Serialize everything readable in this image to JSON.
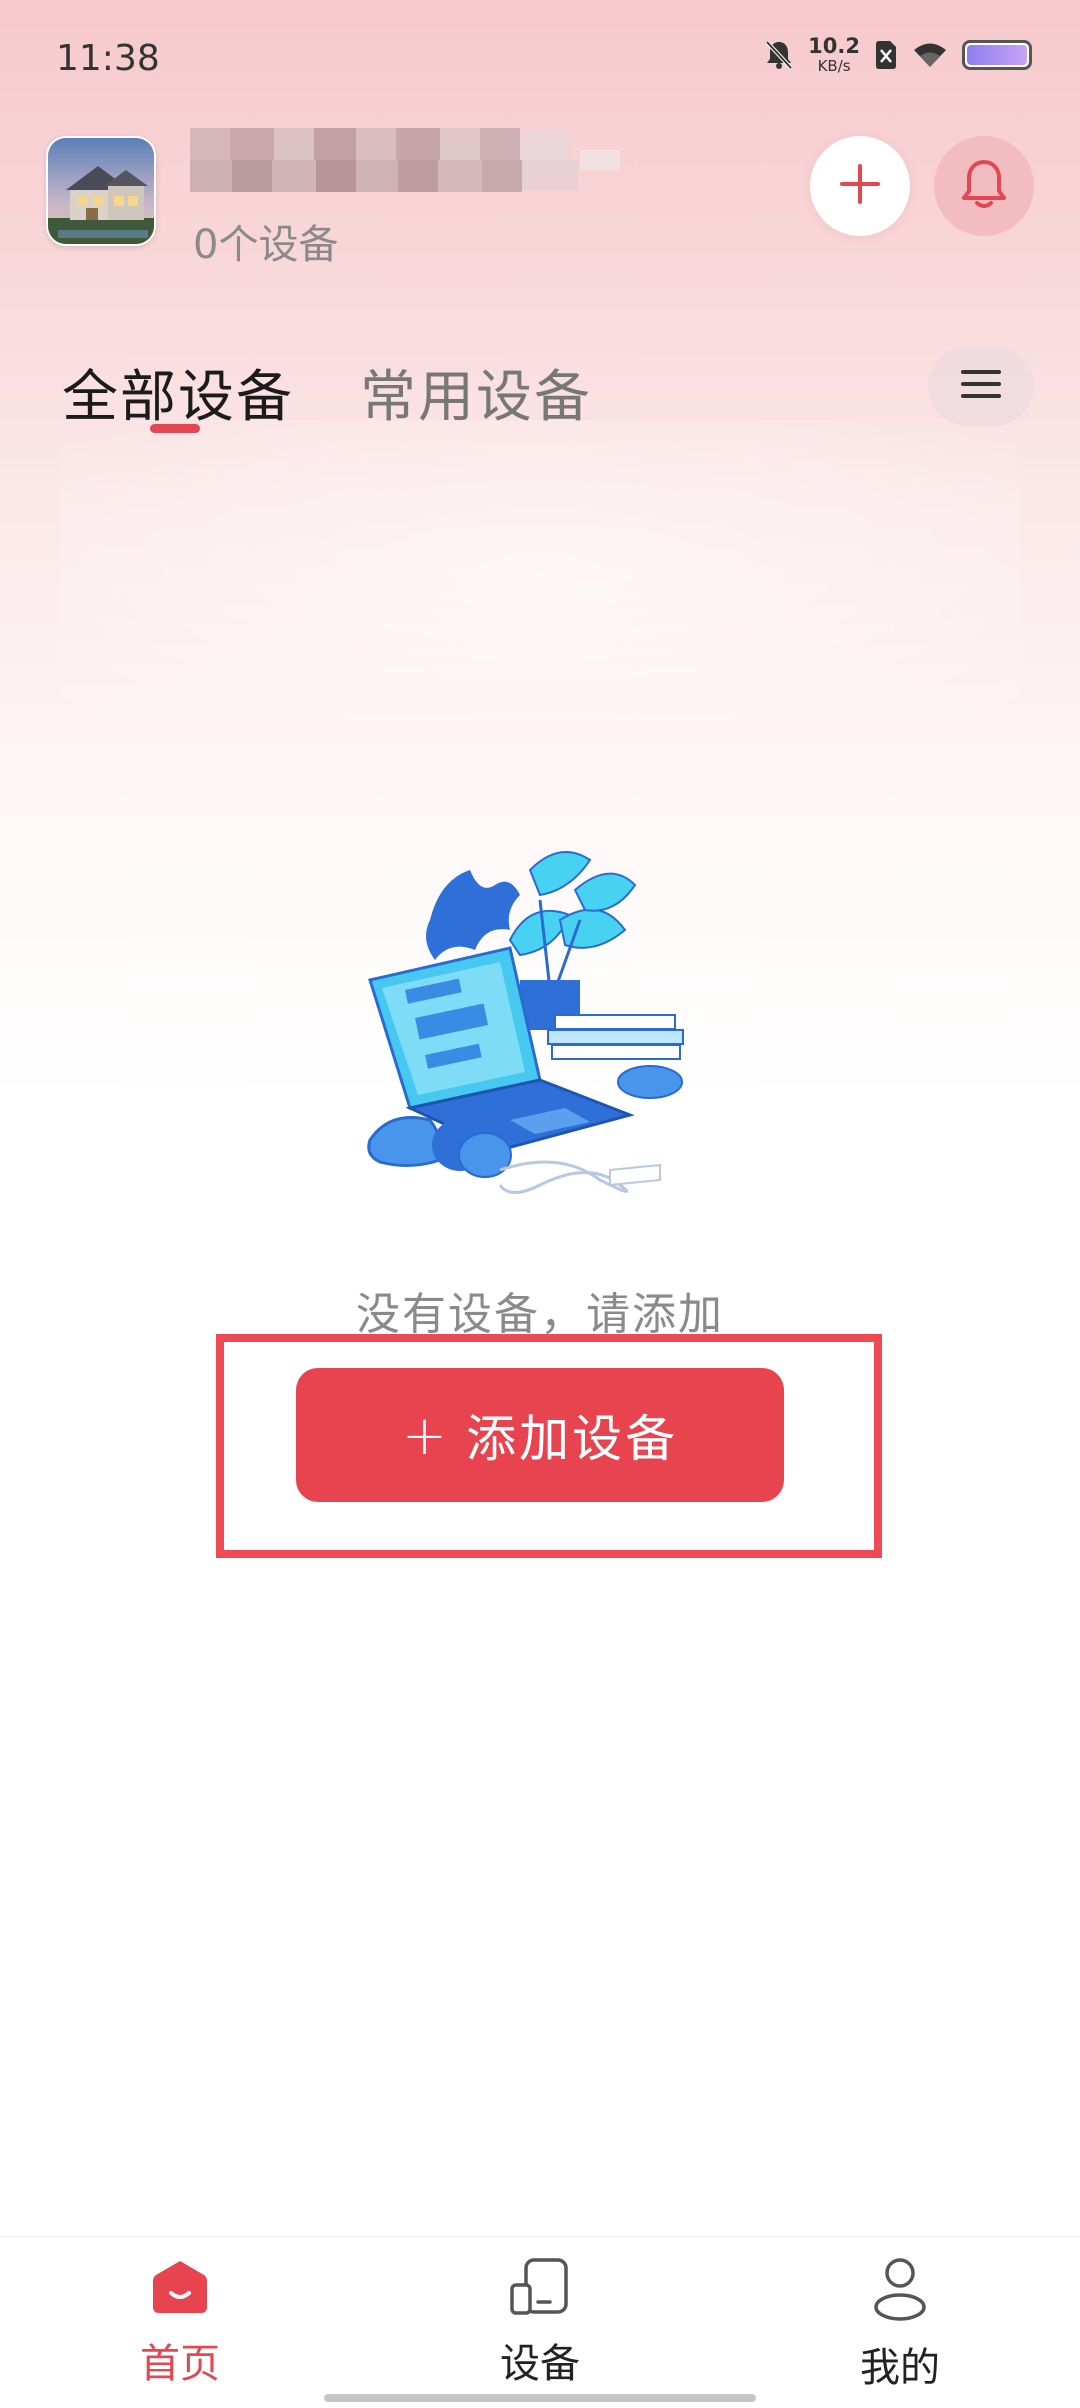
{
  "status_bar": {
    "time": "11:38",
    "net_speed_value": "10.2",
    "net_speed_unit": "KB/s",
    "icons": [
      "bell-off-icon",
      "net-speed-indicator",
      "sim-blocked-icon",
      "wifi-icon",
      "battery-icon"
    ]
  },
  "header": {
    "avatar": "house-avatar",
    "home_name": "",
    "device_count": "0个设备",
    "add_icon": "plus-icon",
    "notification_icon": "bell-icon"
  },
  "tabs": [
    {
      "label": "全部设备",
      "active": true
    },
    {
      "label": "常用设备",
      "active": false
    }
  ],
  "menu_icon": "hamburger-menu-icon",
  "empty_state": {
    "illustration": "laptop-plant-illustration",
    "message": "没有设备，请添加",
    "button_icon": "+",
    "button_label": "添加设备"
  },
  "bottom_nav": [
    {
      "label": "首页",
      "icon": "home-icon",
      "active": true
    },
    {
      "label": "设备",
      "icon": "device-icon",
      "active": false
    },
    {
      "label": "我的",
      "icon": "profile-icon",
      "active": false
    }
  ],
  "colors": {
    "accent": "#e84450",
    "highlight_border": "#ef4a53",
    "muted_text": "#8a8a8a",
    "illustration_blue": "#3b7de0",
    "illustration_cyan": "#46d2f0"
  }
}
